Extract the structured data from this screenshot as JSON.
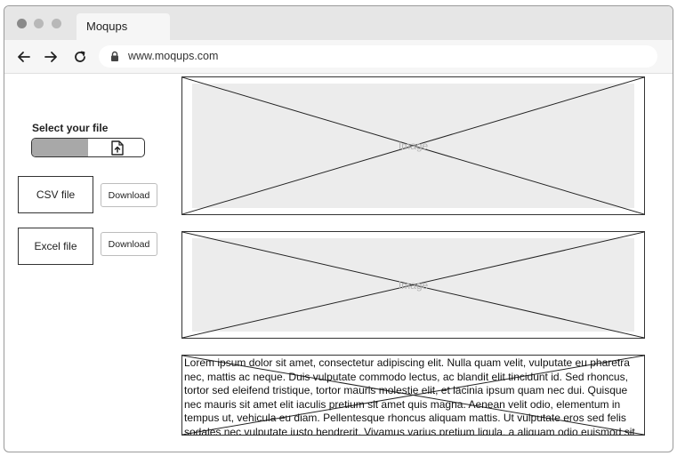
{
  "browser": {
    "tab_title": "Moqups",
    "url": "www.moqups.com"
  },
  "icons": {
    "back": "arrow-left-icon",
    "forward": "arrow-right-icon",
    "reload": "reload-icon",
    "lock": "lock-icon",
    "upload": "file-upload-icon"
  },
  "sidebar": {
    "select_label": "Select your file",
    "upload_progress_fraction": 0.5,
    "csv_label": "CSV file",
    "excel_label": "Excel file",
    "download_label": "Download"
  },
  "main": {
    "image1_label": "Image",
    "image2_label": "Image",
    "paragraph": "Lorem ipsum dolor sit amet, consectetur adipiscing elit. Nulla quam velit, vulputate eu pharetra nec, mattis ac neque. Duis vulputate commodo lectus, ac blandit elit tincidunt id. Sed rhoncus, tortor sed eleifend tristique, tortor mauris molestie elit, et lacinia ipsum quam nec dui. Quisque nec mauris sit amet elit iaculis pretium sit amet quis magna. Aenean velit odio, elementum in tempus ut, vehicula eu diam. Pellentesque rhoncus aliquam mattis. Ut vulputate eros sed felis sodales nec vulputate justo hendrerit. Vivamus varius pretium ligula, a aliquam odio euismod sit amet. Quisque laoreet"
  },
  "colors": {
    "placeholder_fill": "#ececec",
    "progress_fill": "#a8a8a8",
    "chrome": "#e6e6e6"
  }
}
